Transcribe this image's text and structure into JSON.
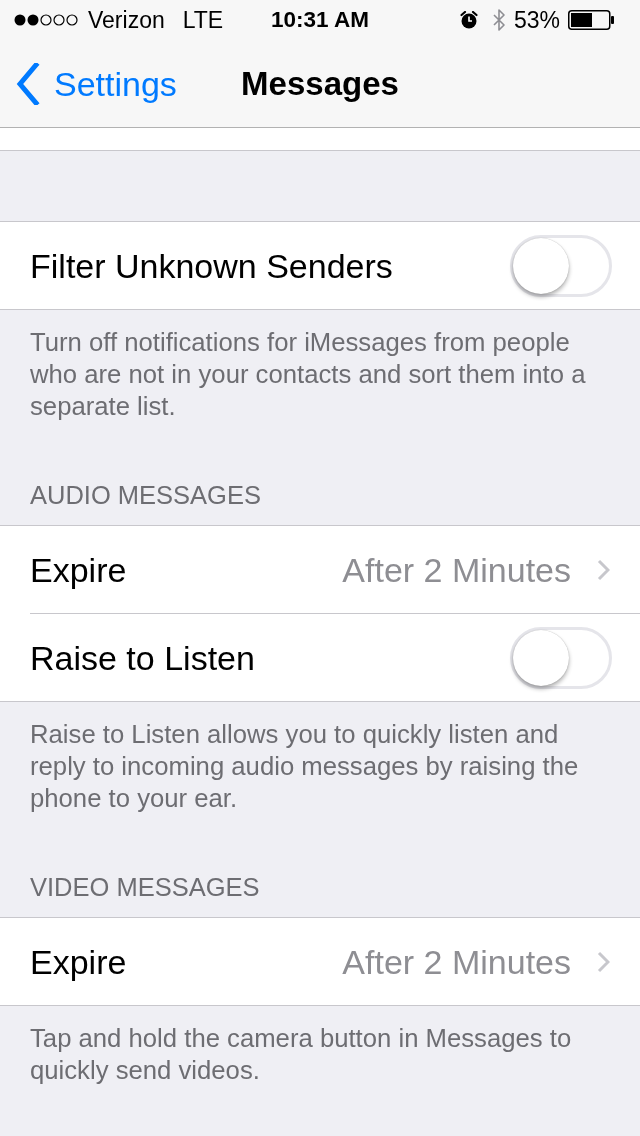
{
  "status_bar": {
    "carrier": "Verizon",
    "network": "LTE",
    "time": "10:31 AM",
    "battery": "53%"
  },
  "nav_bar": {
    "back_label": "Settings",
    "title": "Messages"
  },
  "sections": [
    {
      "rows": [
        {
          "kind": "toggle",
          "label": "Filter Unknown Senders",
          "on": false
        }
      ],
      "footer": "Turn off notifications for iMessages from people who are not in your contacts and sort them into a separate list."
    },
    {
      "header": "AUDIO MESSAGES",
      "rows": [
        {
          "kind": "disclosure",
          "label": "Expire",
          "value": "After 2 Minutes"
        },
        {
          "kind": "toggle",
          "label": "Raise to Listen",
          "on": false
        }
      ],
      "footer": "Raise to Listen allows you to quickly listen and reply to incoming audio messages by raising the phone to your ear."
    },
    {
      "header": "VIDEO MESSAGES",
      "rows": [
        {
          "kind": "disclosure",
          "label": "Expire",
          "value": "After 2 Minutes"
        }
      ],
      "footer": "Tap and hold the camera button in Messages to quickly send videos."
    }
  ]
}
